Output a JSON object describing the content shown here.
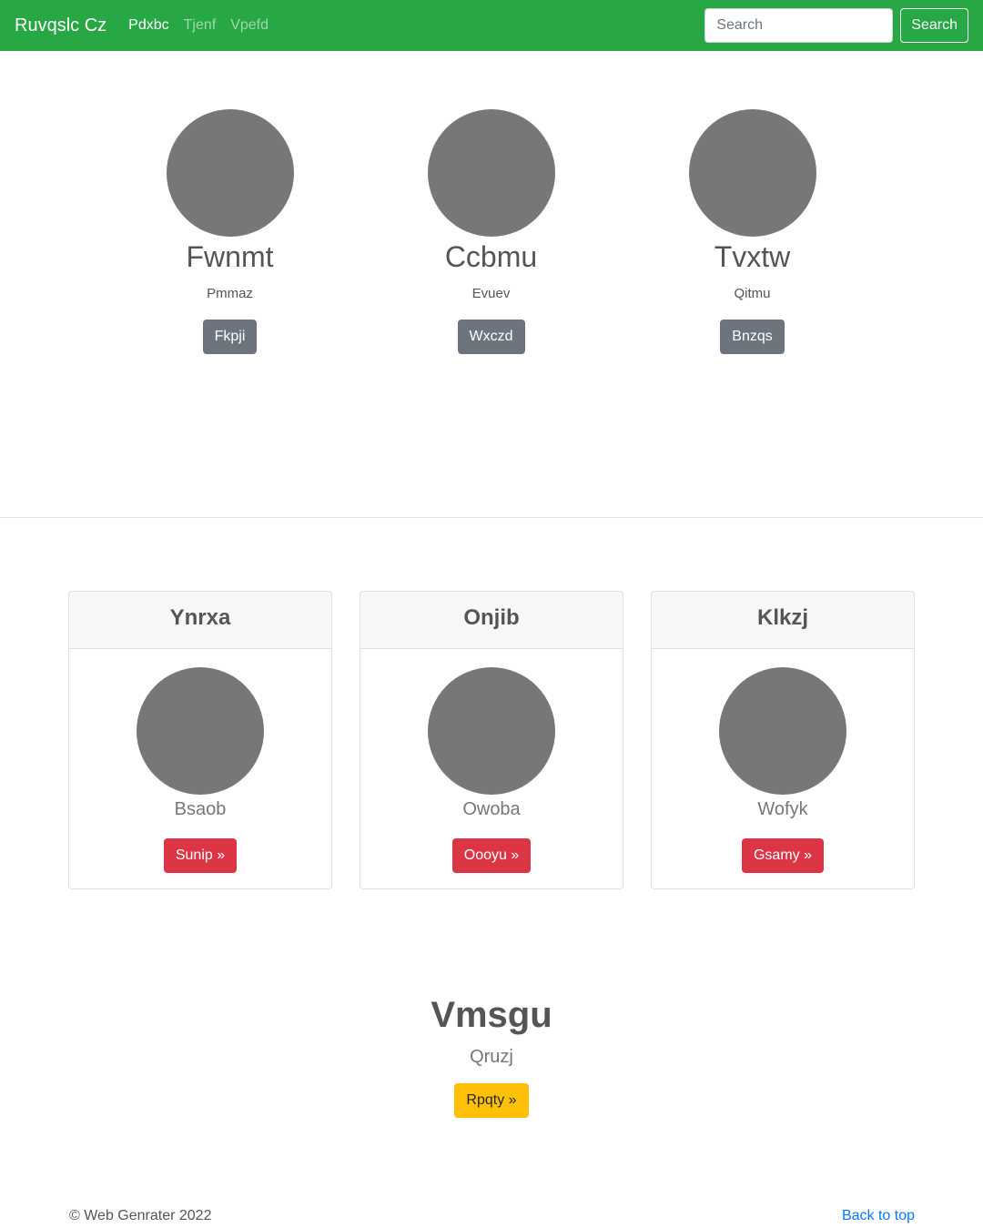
{
  "navbar": {
    "brand": "Ruvqslc Cz",
    "links": [
      {
        "label": "Pdxbc",
        "active": true
      },
      {
        "label": "Tjenf",
        "active": false
      },
      {
        "label": "Vpefd",
        "active": false
      }
    ],
    "search_placeholder": "Search",
    "search_button": "Search"
  },
  "profiles": [
    {
      "name": "Fwnmt",
      "sub": "Pmmaz",
      "button": "Fkpji"
    },
    {
      "name": "Ccbmu",
      "sub": "Evuev",
      "button": "Wxczd"
    },
    {
      "name": "Tvxtw",
      "sub": "Qitmu",
      "button": "Bnzqs"
    }
  ],
  "cards": [
    {
      "header": "Ynrxa",
      "sub": "Bsaob",
      "button": "Sunip »"
    },
    {
      "header": "Onjib",
      "sub": "Owoba",
      "button": "Oooyu »"
    },
    {
      "header": "Klkzj",
      "sub": "Wofyk",
      "button": "Gsamy »"
    }
  ],
  "hero": {
    "title": "Vmsgu",
    "sub": "Qruzj",
    "button": "Rpqty »"
  },
  "footer": {
    "copyright": "© Web Genrater 2022",
    "back_to_top": "Back to top"
  },
  "colors": {
    "navbar": "#28a745",
    "secondary": "#6c757d",
    "danger": "#dc3545",
    "warning": "#ffc107",
    "link": "#007bff",
    "placeholder_image": "#777777"
  }
}
